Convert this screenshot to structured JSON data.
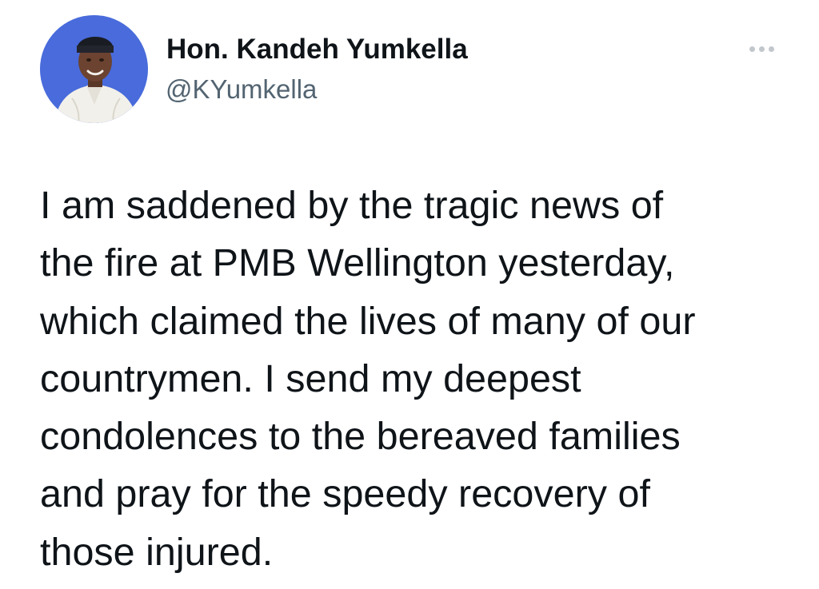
{
  "tweet": {
    "author": {
      "name": "Hon. Kandeh Yumkella",
      "handle": "@KYumkella",
      "avatar_icon": "profile-photo"
    },
    "more_icon": "more-options-icon",
    "text_lines": [
      "I am saddened by the tragic news of",
      "the fire at PMB Wellington yesterday,",
      "which claimed the lives of many of our",
      "countrymen. I send my deepest",
      "condolences to the bereaved families",
      "and pray for the speedy recovery of",
      "those injured."
    ],
    "colors": {
      "text": "#0f1419",
      "secondary": "#536471",
      "avatar_background": "#3f62d6"
    }
  }
}
